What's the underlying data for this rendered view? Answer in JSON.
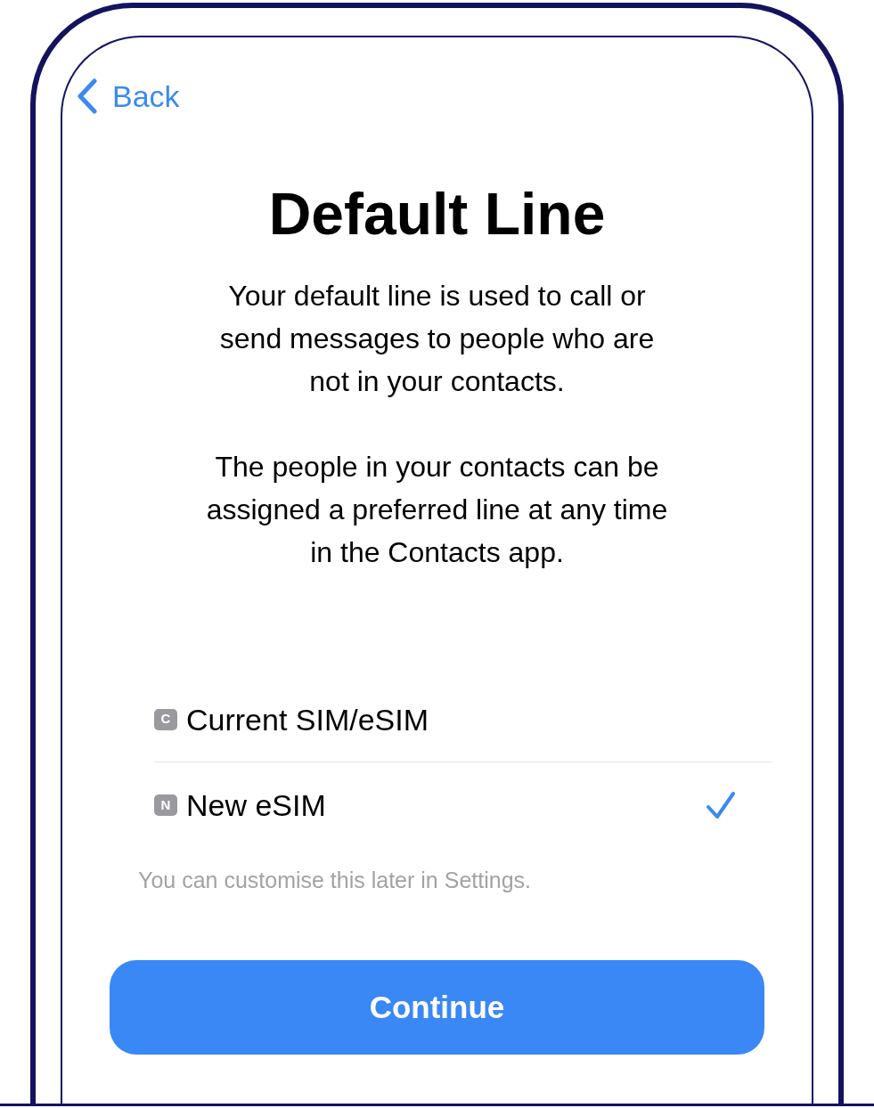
{
  "nav": {
    "back": "Back"
  },
  "title": "Default Line",
  "paragraphs": [
    "Your default line is used to call or send messages to people who are not in your contacts.",
    "The people in your contacts can be assigned a preferred line at any time in the Contacts app."
  ],
  "lines": [
    {
      "badge": "C",
      "label": "Current SIM/eSIM",
      "selected": false
    },
    {
      "badge": "N",
      "label": "New eSIM",
      "selected": true
    }
  ],
  "note": "You can customise this later in Settings.",
  "button": "Continue"
}
